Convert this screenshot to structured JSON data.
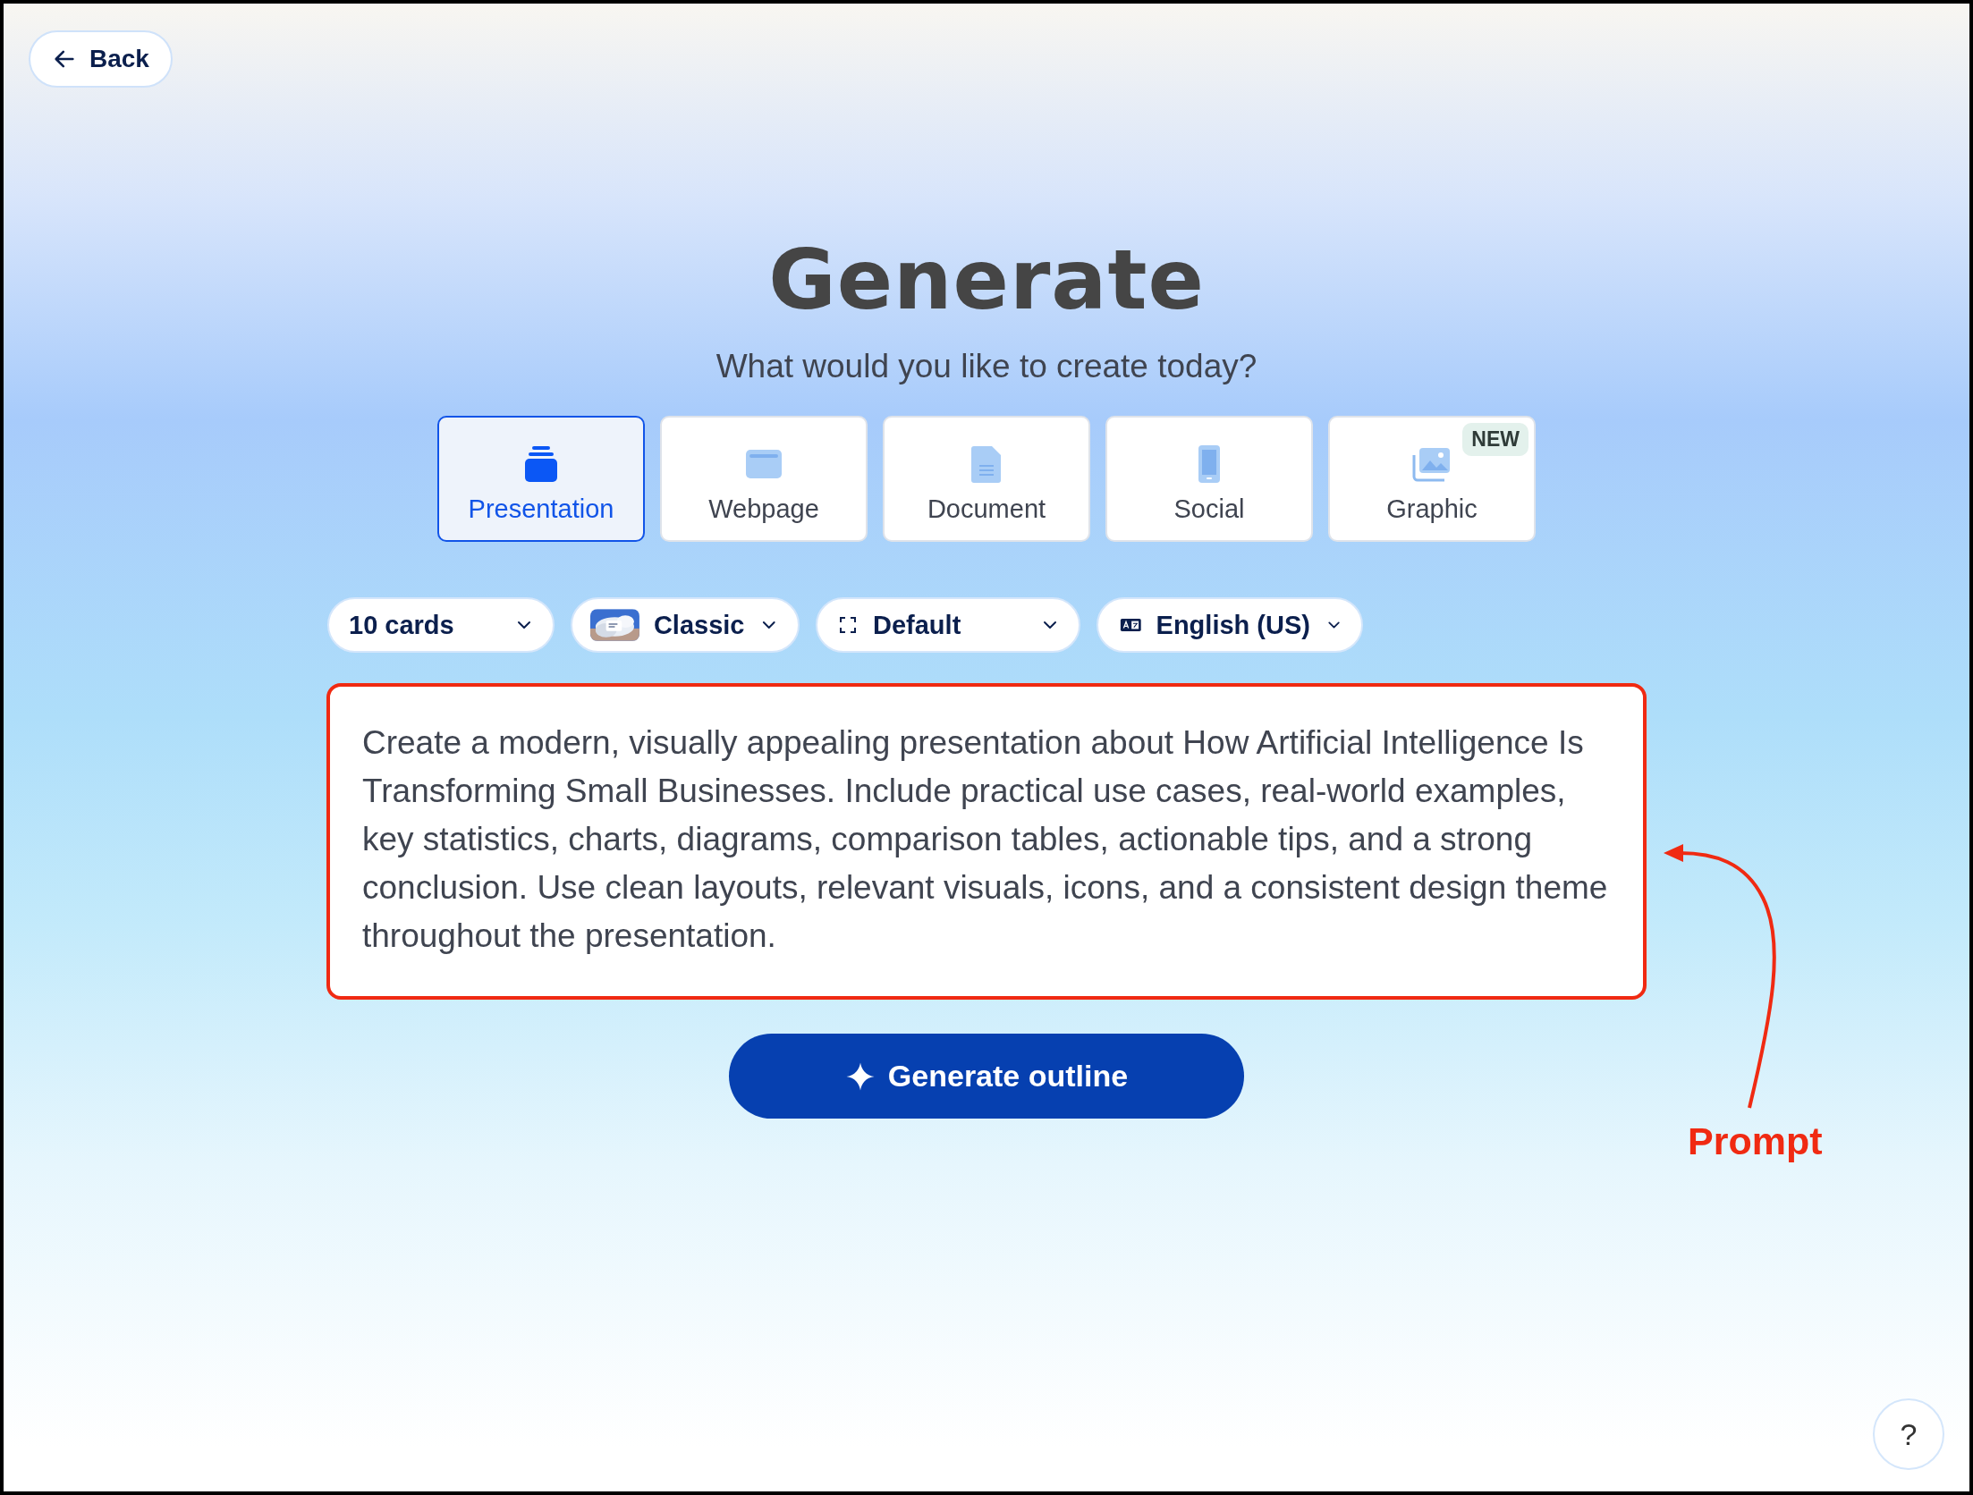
{
  "back_button": {
    "label": "Back"
  },
  "title": "Generate",
  "subtitle": "What would you like to create today?",
  "tabs": [
    {
      "label": "Presentation",
      "kind": "presentation",
      "selected": true
    },
    {
      "label": "Webpage",
      "kind": "webpage",
      "selected": false
    },
    {
      "label": "Document",
      "kind": "document",
      "selected": false
    },
    {
      "label": "Social",
      "kind": "social",
      "selected": false
    },
    {
      "label": "Graphic",
      "kind": "graphic",
      "selected": false,
      "badge": "NEW"
    }
  ],
  "options": [
    {
      "label": "10 cards",
      "kind": "plain"
    },
    {
      "label": "Classic",
      "kind": "theme"
    },
    {
      "label": "Default",
      "kind": "frame"
    },
    {
      "label": "English (US)",
      "kind": "language"
    }
  ],
  "prompt": {
    "value": "Create a modern, visually appealing presentation about How Artificial Intelligence Is Transforming Small Businesses. Include practical use cases, real-world examples, key statistics, charts, diagrams, comparison tables, actionable tips, and a strong conclusion. Use clean layouts, relevant visuals, icons, and a consistent design theme throughout the presentation."
  },
  "generate_button": {
    "label": "Generate outline"
  },
  "annotation": {
    "label": "Prompt"
  },
  "help_button": {
    "label": "?"
  }
}
